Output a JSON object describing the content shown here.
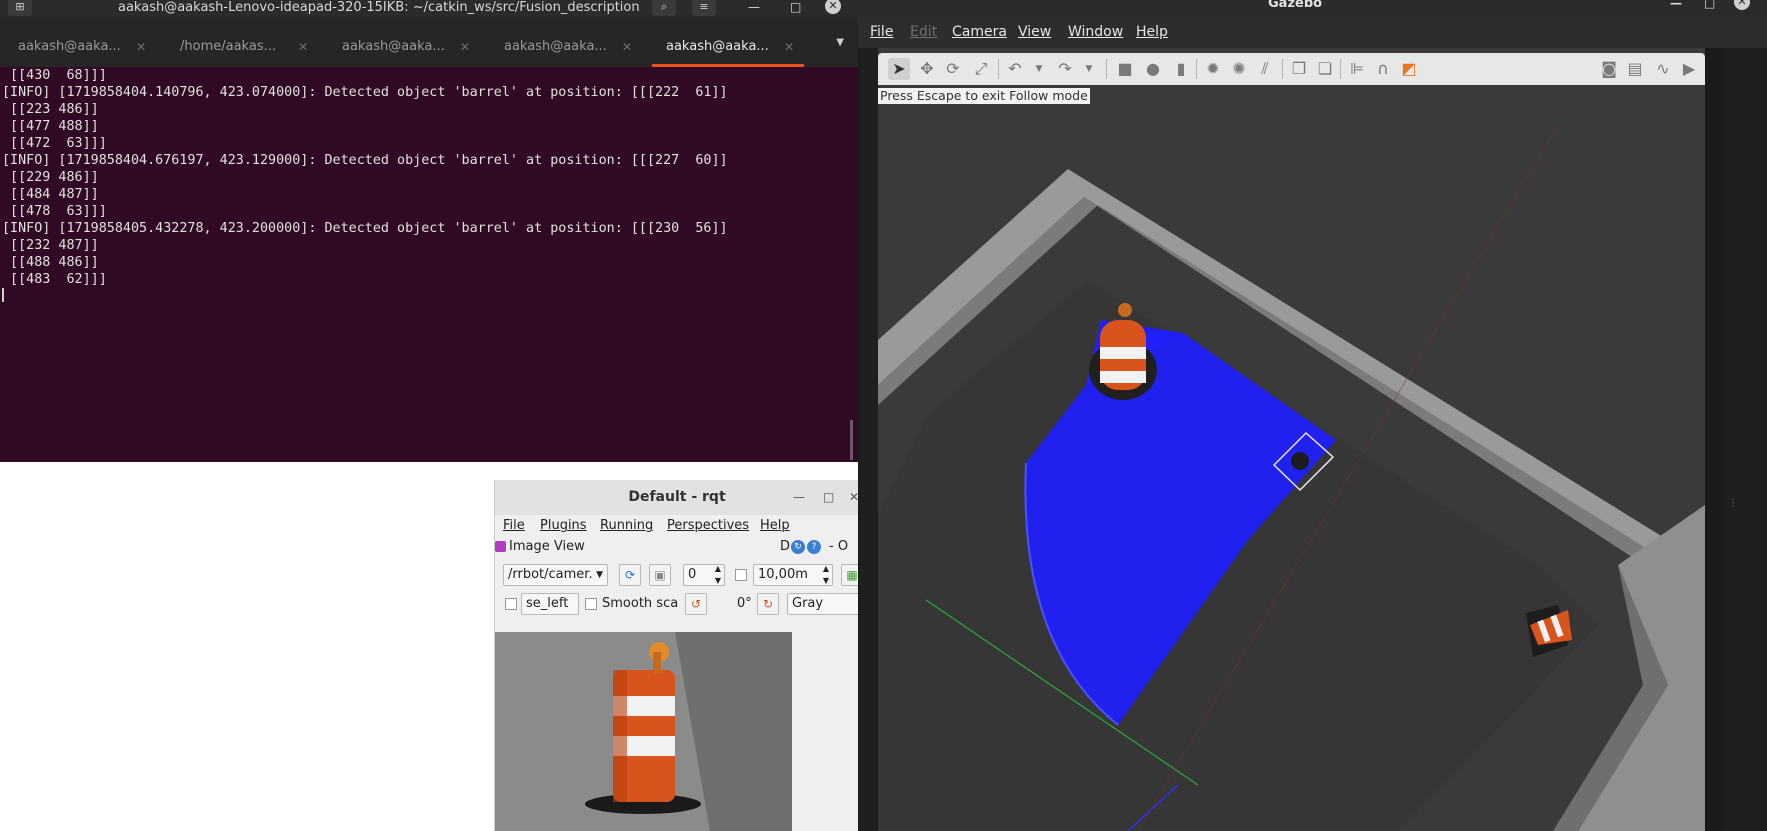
{
  "terminal": {
    "title": "aakash@aakash-Lenovo-ideapad-320-15IKB: ~/catkin_ws/src/Fusion_description",
    "tabs": [
      {
        "label": "aakash@aaka...",
        "active": false
      },
      {
        "label": "/home/aakas...",
        "active": false
      },
      {
        "label": "aakash@aaka...",
        "active": false
      },
      {
        "label": "aakash@aaka...",
        "active": false
      },
      {
        "label": "aakash@aaka...",
        "active": true
      }
    ],
    "lines": [
      " [[430  68]]]",
      "[INFO] [1719858404.140796, 423.074000]: Detected object 'barrel' at position: [[[222  61]]",
      "",
      " [[223 486]]",
      "",
      " [[477 488]]",
      "",
      " [[472  63]]]",
      "[INFO] [1719858404.676197, 423.129000]: Detected object 'barrel' at position: [[[227  60]]",
      "",
      " [[229 486]]",
      "",
      " [[484 487]]",
      "",
      " [[478  63]]]",
      "[INFO] [1719858405.432278, 423.200000]: Detected object 'barrel' at position: [[[230  56]]",
      "",
      " [[232 487]]",
      "",
      " [[488 486]]",
      "",
      " [[483  62]]]"
    ]
  },
  "rqt": {
    "title": "Default - rqt",
    "menu": [
      "File",
      "Plugins",
      "Running",
      "Perspectives",
      "Help"
    ],
    "plugin_title": "Image View",
    "plugin_right": "D",
    "plugin_right2": "- O",
    "topic": "/rrbot/camer.",
    "spin_value": "0",
    "distance": "10,00m",
    "use_left_label": "se_left",
    "smooth_label": "Smooth scali",
    "rotation": "0°",
    "color_scheme": "Gray"
  },
  "gazebo": {
    "title": "Gazebo",
    "menu": [
      {
        "label": "File",
        "enabled": true
      },
      {
        "label": "Edit",
        "enabled": false
      },
      {
        "label": "Camera",
        "enabled": true
      },
      {
        "label": "View",
        "enabled": true
      },
      {
        "label": "Window",
        "enabled": true
      },
      {
        "label": "Help",
        "enabled": true
      }
    ],
    "follow_message": "Press Escape to exit Follow mode",
    "toolbar_icons": [
      "select-arrow-icon",
      "translate-icon",
      "rotate-icon",
      "scale-icon",
      "undo-icon",
      "redo-icon",
      "box-icon",
      "sphere-icon",
      "cylinder-icon",
      "point-light-icon",
      "spot-light-icon",
      "directional-light-icon",
      "copy-icon",
      "paste-icon",
      "align-icon",
      "snap-icon",
      "view-angle-icon",
      "screenshot-icon",
      "log-icon",
      "plot-icon",
      "video-icon"
    ]
  },
  "colors": {
    "terminal_bg": "#300a24",
    "terminal_tab_accent": "#e95420",
    "gazebo_floor": "#3a3a3a",
    "gazebo_wall": "#8f8f8f",
    "laser_blue": "#1f1fff",
    "cone_orange": "#d8541c"
  }
}
